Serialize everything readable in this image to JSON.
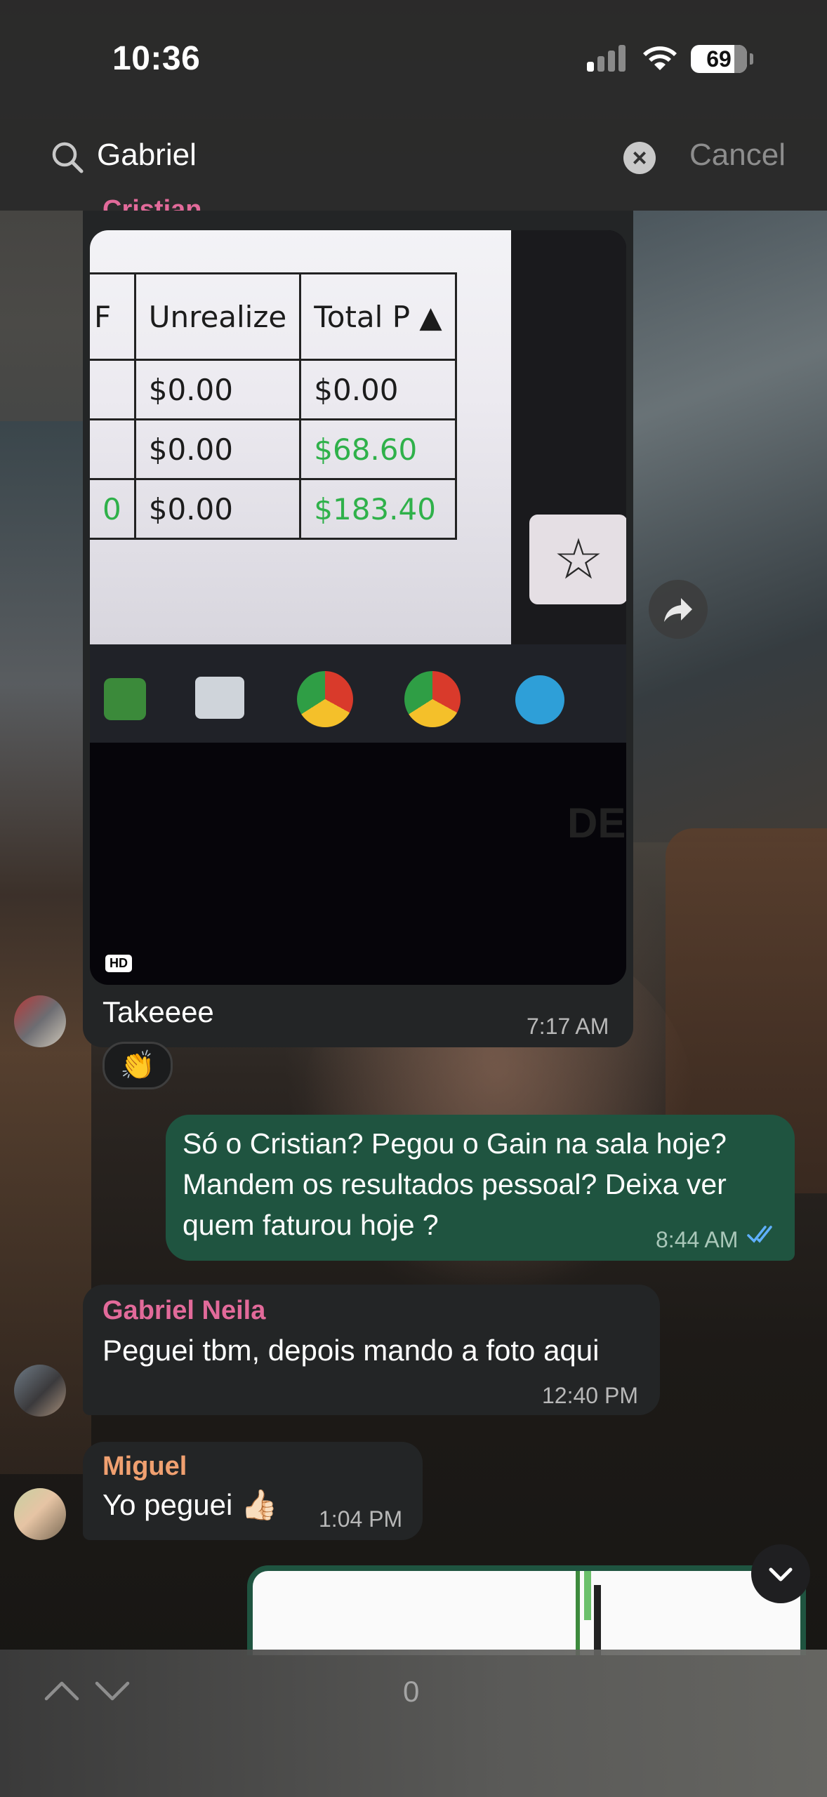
{
  "status": {
    "time": "10:36",
    "battery": "69"
  },
  "search": {
    "query": "Gabriel",
    "cancel_label": "Cancel"
  },
  "image_message": {
    "sender": "Cristian",
    "photo": {
      "headers": [
        "Unrealize",
        "Total P"
      ],
      "rows": [
        [
          "$0.00",
          "$0.00"
        ],
        [
          "$0.00",
          "$68.60"
        ],
        [
          "$0.00",
          "$183.40"
        ]
      ],
      "badge": "HD",
      "watermark": "DELL"
    },
    "caption": "Takeeee",
    "time": "7:17 AM",
    "reaction": "👏"
  },
  "outgoing": {
    "text": "Só o Cristian? Pegou o Gain na sala hoje? Mandem os resultados pessoal? Deixa ver quem faturou hoje ?",
    "time": "8:44 AM"
  },
  "messages": [
    {
      "sender": "Gabriel Neila",
      "text": "Peguei tbm, depois mando a foto aqui",
      "time": "12:40 PM",
      "color": "#e26a9a"
    },
    {
      "sender": "Miguel",
      "text": "Yo peguei 👍🏻",
      "time": "1:04 PM",
      "color": "#f0a070"
    }
  ],
  "bottom": {
    "result_count": "0"
  }
}
